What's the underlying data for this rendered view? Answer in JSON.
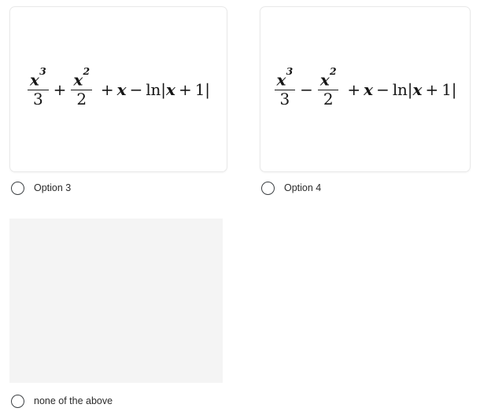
{
  "quiz": {
    "options": [
      {
        "id": "option-3",
        "label": "Option 3",
        "card_type": "formula",
        "formula": {
          "latex": "\\frac{x^3}{3} + \\frac{x^2}{2} + x - \\ln|x + 1|",
          "plain": "x^3/3 + x^2/2 + x - ln|x + 1|",
          "frac1_num_base": "x",
          "frac1_num_exp": "3",
          "frac1_den": "3",
          "operator_between_fractions": "+",
          "frac2_num_base": "x",
          "frac2_num_exp": "2",
          "frac2_den": "2",
          "tail_plus": "+",
          "tail_var": "x",
          "tail_minus": "−",
          "tail_ln": "ln",
          "tail_bar_open": "|",
          "tail_inner_var": "x",
          "tail_inner_plus": "+",
          "tail_inner_num": "1",
          "tail_bar_close": "|"
        }
      },
      {
        "id": "option-4",
        "label": "Option 4",
        "card_type": "formula",
        "formula": {
          "latex": "\\frac{x^3}{3} - \\frac{x^2}{2} + x - \\ln|x + 1|",
          "plain": "x^3/3 - x^2/2 + x - ln|x + 1|",
          "frac1_num_base": "x",
          "frac1_num_exp": "3",
          "frac1_den": "3",
          "operator_between_fractions": "−",
          "frac2_num_base": "x",
          "frac2_num_exp": "2",
          "frac2_den": "2",
          "tail_plus": "+",
          "tail_var": "x",
          "tail_minus": "−",
          "tail_ln": "ln",
          "tail_bar_open": "|",
          "tail_inner_var": "x",
          "tail_inner_plus": "+",
          "tail_inner_num": "1",
          "tail_bar_close": "|"
        }
      },
      {
        "id": "none-of-the-above",
        "label": "none of the above",
        "card_type": "blank",
        "formula": null
      }
    ]
  },
  "colors": {
    "page_background": "#ffffff",
    "card_background": "#ffffff",
    "card_border": "#e9e9e9",
    "blank_card_background": "#f4f4f4",
    "math_text": "#161616",
    "label_text": "#2b2b2b",
    "radio_ring": "#3c4043"
  }
}
